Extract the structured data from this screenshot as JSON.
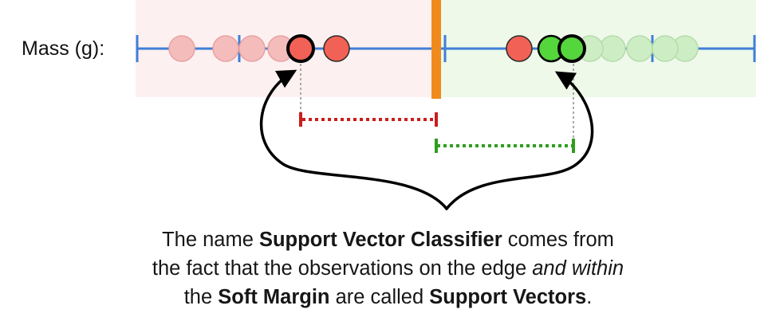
{
  "axis": {
    "label": "Mass (g):"
  },
  "classes": {
    "left_color": "#f26155",
    "left_faded_color": "#f5bcbc",
    "right_color": "#55d63c",
    "right_faded_color": "#cdeec4",
    "left_region_color": "#fdf0f0",
    "right_region_color": "#eef9ea",
    "threshold_color": "#f08a1c",
    "axis_color": "#3f7fd6",
    "left_margin_color": "#c81e1e",
    "right_margin_color": "#2f9e1e"
  },
  "observations": {
    "left_faded_count": 4,
    "left_support_vectors": 1,
    "left_inside_margin": 1,
    "right_inside_margin": 1,
    "right_support_vectors": 1,
    "right_faded_count": 4
  },
  "caption": {
    "line1": {
      "t1": "The name ",
      "b1": "Support Vector Classifier",
      "t2": " comes from"
    },
    "line2": {
      "t1": "the fact that the observations on the edge ",
      "i1": "and within"
    },
    "line3": {
      "t1": "the ",
      "b1": "Soft Margin",
      "t2": " are called ",
      "b2": "Support Vectors",
      "t3": "."
    }
  }
}
